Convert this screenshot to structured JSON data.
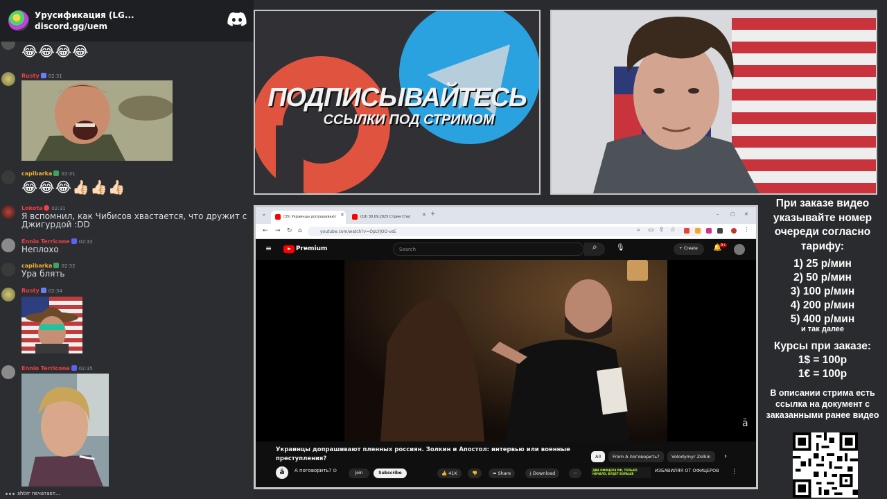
{
  "discord": {
    "server_name": "Урусификация (LG...",
    "invite": "discord.gg/uem",
    "messages": [
      {
        "user": "",
        "time": "",
        "content": "😂😂😂😂",
        "user_color": "#dbdee1"
      },
      {
        "user": "Rusty",
        "time": "02:31",
        "content": "",
        "user_color": "#f23f43",
        "attachment": "gif-laughing-officer"
      },
      {
        "user": "capibarka",
        "time": "02:31",
        "content": "😂😂😂👍🏻👍🏻👍🏻",
        "user_color": "#f0b232"
      },
      {
        "user": "Lokota",
        "time": "02:31",
        "content": "Я вспомнил, как Чибисов хвастается, что дружит с Джигурдой :DD",
        "user_color": "#f23f43"
      },
      {
        "user": "Ennio Terricone",
        "time": "02:32",
        "content": "Неплохо",
        "user_color": "#f23f43"
      },
      {
        "user": "capibarka",
        "time": "02:32",
        "content": "Ура блять",
        "user_color": "#f0b232"
      },
      {
        "user": "Rusty",
        "time": "02:34",
        "content": "",
        "user_color": "#f23f43",
        "attachment": "gif-cowboy-flag"
      },
      {
        "user": "Ennio Terricone",
        "time": "02:35",
        "content": "",
        "user_color": "#f23f43",
        "attachment": "gif-smoking-man"
      }
    ],
    "typing": "shtirr печатает..."
  },
  "promo": {
    "title": "ПОДПИСЫВАЙТЕСЬ",
    "subtitle": "ССЫЛКИ ПОД СТРИМОМ",
    "icons": [
      "patreon-icon",
      "telegram-icon"
    ],
    "colors": {
      "patreon": "#e0543f",
      "telegram": "#2aa2df"
    }
  },
  "browser": {
    "tabs": [
      {
        "label": "(35) Украинцы допрашивают",
        "active": true
      },
      {
        "label": "(18) 30.09.2025 Стрим Chat",
        "active": false
      }
    ],
    "url": "youtube.com/watch?v=OpLYJOO-vsE",
    "youtube": {
      "brand": "Premium",
      "search_placeholder": "Search",
      "create_label": "Create",
      "notifications": "9+",
      "video_title": "Украинцы допрашивают пленных россиян. Золкин и Апостол: интервью или военные преступления?",
      "channel": "А поговорить? ⊙",
      "join": "Join",
      "subscribe": "Subscribe",
      "likes": "41K",
      "share": "Share",
      "download": "Download",
      "more": "···",
      "chips": [
        "All",
        "From А поговорить?",
        "Volodymyr Zolkin"
      ],
      "rec_thumb_text": "ДВА ОФИЦЕРА РФ, ТОЛЬКО НАЧАЛО, БУДЕТ БОЛЬШЕ",
      "rec_title": "ИЗБАВИЛЯЯ ОТ ОФИЦЕРОВ"
    }
  },
  "info": {
    "heading": "При заказе видео указывайте номер очереди согласно тарифу:",
    "rates": [
      "1) 25 р/мин",
      "2) 50 р/мин",
      "3) 100 р/мин",
      "4) 200 р/мин",
      "5) 400 р/мин"
    ],
    "rates_more": "и так далее",
    "courses_title": "Курсы при заказе:",
    "courses": [
      "1$ = 100р",
      "1€ = 100р"
    ],
    "description_note": "В описании стрима есть ссылка на документ с заказанными ранее видео"
  },
  "colors": {
    "background": "#2a2b2e",
    "discord_bg": "#2b2d31",
    "youtube_red": "#ff0000",
    "border": "#c8c8c8"
  }
}
